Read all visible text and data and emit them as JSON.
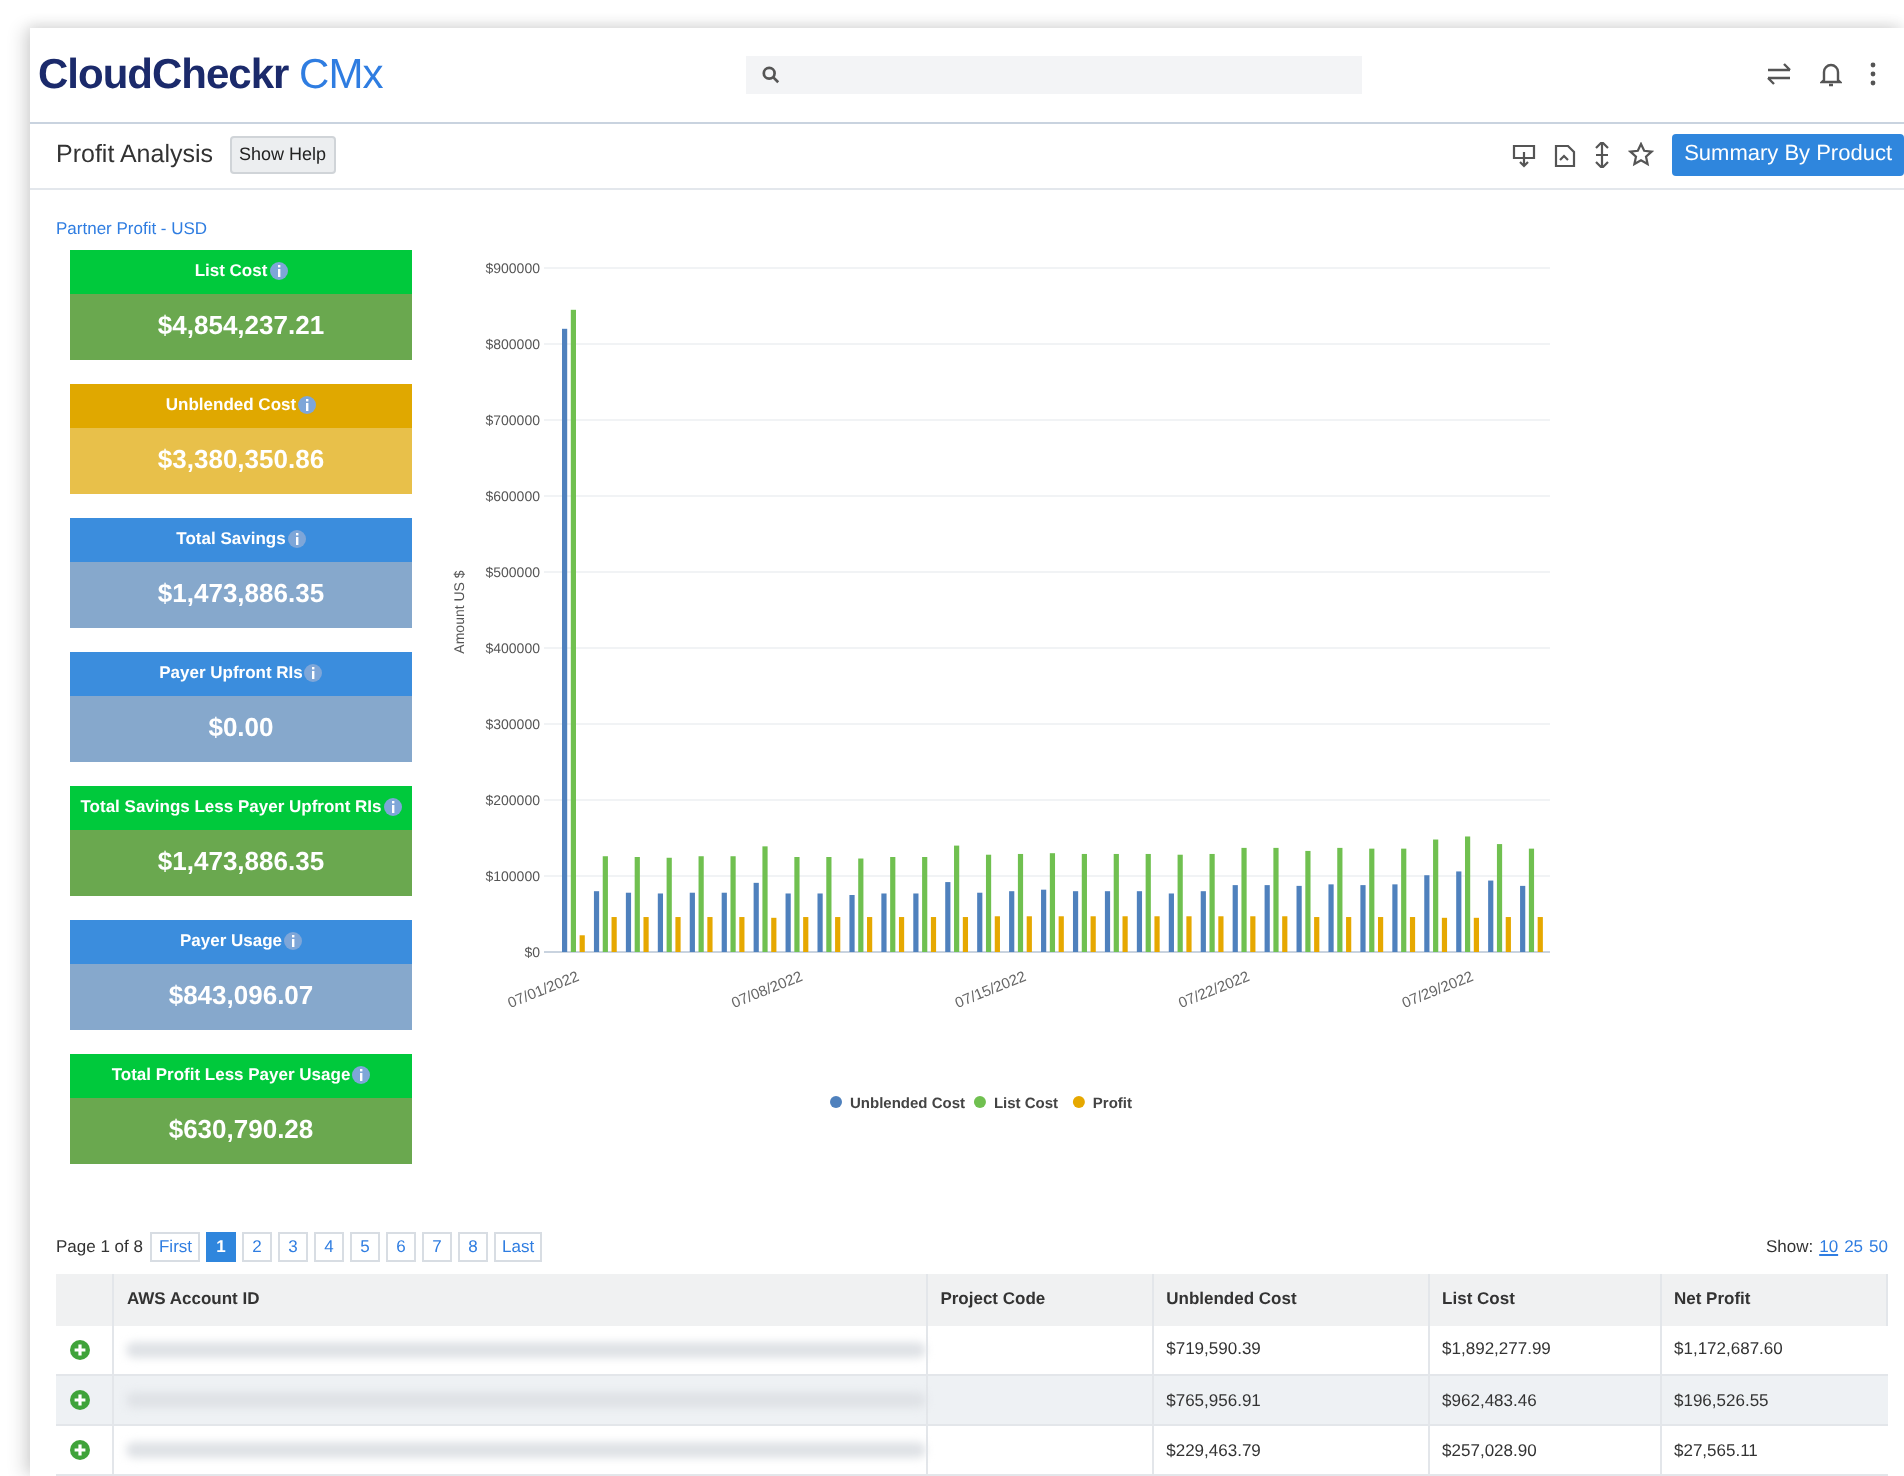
{
  "header": {
    "logo": {
      "brand": "CloudCheckr",
      "product": "CMx"
    }
  },
  "toolbar": {
    "title": "Profit Analysis",
    "help_button": "Show Help",
    "summary_button": "Summary By Product"
  },
  "subtitle": "Partner Profit - USD",
  "kpis": [
    {
      "label": "List Cost",
      "value": "$4,854,237.21",
      "kind": "green"
    },
    {
      "label": "Unblended Cost",
      "value": "$3,380,350.86",
      "kind": "gold"
    },
    {
      "label": "Total Savings",
      "value": "$1,473,886.35",
      "kind": "blue"
    },
    {
      "label": "Payer Upfront RIs",
      "value": "$0.00",
      "kind": "blue"
    },
    {
      "label": "Total Savings Less Payer Upfront RIs",
      "value": "$1,473,886.35",
      "kind": "green"
    },
    {
      "label": "Payer Usage",
      "value": "$843,096.07",
      "kind": "blue"
    },
    {
      "label": "Total Profit Less Payer Usage",
      "value": "$630,790.28",
      "kind": "green"
    }
  ],
  "chart_data": {
    "type": "bar",
    "ylabel": "Amount US $",
    "grid": true,
    "legend": "bottom",
    "stacked": false,
    "xlabel": null,
    "categories": [
      "07/01/2022",
      null,
      null,
      null,
      null,
      null,
      null,
      "07/08/2022",
      null,
      null,
      null,
      null,
      null,
      null,
      "07/15/2022",
      null,
      null,
      null,
      null,
      null,
      null,
      "07/22/2022",
      null,
      null,
      null,
      null,
      null,
      null,
      "07/29/2022",
      null,
      null
    ],
    "series": [
      {
        "name": "Unblended Cost",
        "color": "#4f81bd",
        "values": [
          820000,
          80000,
          78000,
          77000,
          78000,
          78000,
          91000,
          77000,
          77000,
          75000,
          77000,
          77000,
          92000,
          78000,
          80000,
          82000,
          80000,
          80000,
          80000,
          77000,
          80000,
          88000,
          88000,
          87000,
          89000,
          88000,
          89000,
          101000,
          106000,
          94000,
          87000
        ]
      },
      {
        "name": "List Cost",
        "color": "#70c050",
        "values": [
          845000,
          126000,
          125000,
          124000,
          126000,
          126000,
          139000,
          125000,
          125000,
          123000,
          125000,
          125000,
          140000,
          128000,
          129000,
          130000,
          129000,
          129000,
          129000,
          128000,
          129000,
          137000,
          137000,
          133000,
          137000,
          136000,
          136000,
          148000,
          152000,
          142000,
          136000
        ]
      },
      {
        "name": "Profit",
        "color": "#e6a800",
        "values": [
          22000,
          46000,
          46000,
          46000,
          46000,
          46000,
          45000,
          46000,
          46000,
          46000,
          46000,
          46000,
          46000,
          47000,
          47000,
          47000,
          47000,
          47000,
          47000,
          47000,
          47000,
          47000,
          47000,
          46000,
          46000,
          46000,
          46000,
          45000,
          45000,
          46000,
          46000
        ]
      }
    ],
    "ylim": [
      0,
      900000
    ],
    "yticks": [
      {
        "value": 0,
        "label": "$0"
      },
      {
        "value": 100000,
        "label": "$100000"
      },
      {
        "value": 200000,
        "label": "$200000"
      },
      {
        "value": 300000,
        "label": "$300000"
      },
      {
        "value": 400000,
        "label": "$400000"
      },
      {
        "value": 500000,
        "label": "$500000"
      },
      {
        "value": 600000,
        "label": "$600000"
      },
      {
        "value": 700000,
        "label": "$700000"
      },
      {
        "value": 800000,
        "label": "$800000"
      },
      {
        "value": 900000,
        "label": "$900000"
      }
    ]
  },
  "pagination": {
    "summary": "Page 1 of 8",
    "first": "First",
    "last": "Last",
    "pages": [
      {
        "label": "1",
        "selected": true
      },
      {
        "label": "2",
        "selected": false
      },
      {
        "label": "3",
        "selected": false
      },
      {
        "label": "4",
        "selected": false
      },
      {
        "label": "5",
        "selected": false
      },
      {
        "label": "6",
        "selected": false
      },
      {
        "label": "7",
        "selected": false
      },
      {
        "label": "8",
        "selected": false
      }
    ],
    "show_label": "Show:",
    "sizes": [
      {
        "label": "10",
        "selected": true
      },
      {
        "label": "25",
        "selected": false
      },
      {
        "label": "50",
        "selected": false
      }
    ]
  },
  "table": {
    "columns": [
      "AWS Account ID",
      "Project Code",
      "Unblended Cost",
      "List Cost",
      "Net Profit"
    ],
    "rows": [
      {
        "unblended_cost": "$719,590.39",
        "list_cost": "$1,892,277.99",
        "net_profit": "$1,172,687.60"
      },
      {
        "unblended_cost": "$765,956.91",
        "list_cost": "$962,483.46",
        "net_profit": "$196,526.55"
      },
      {
        "unblended_cost": "$229,463.79",
        "list_cost": "$257,028.90",
        "net_profit": "$27,565.11"
      }
    ]
  }
}
